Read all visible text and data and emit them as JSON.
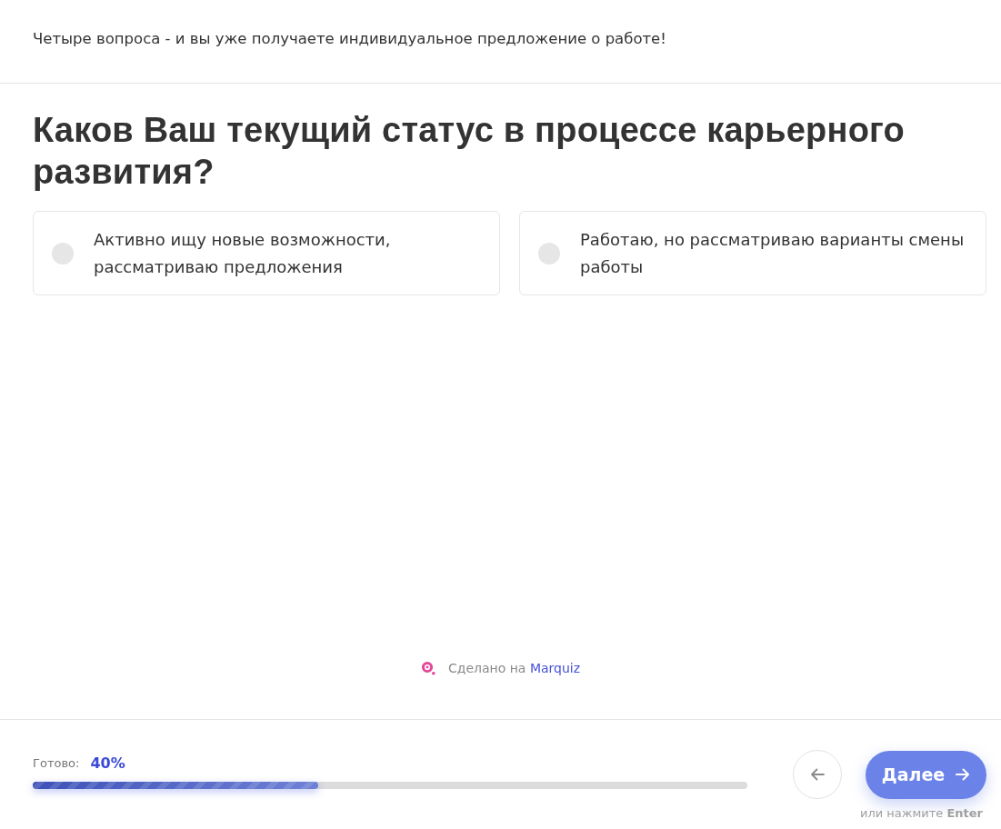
{
  "intro": "Четыре вопроса - и вы уже получаете индивидуальное предложение о работе!",
  "question": {
    "title": "Каков Ваш текущий статус в процессе карьерного развития?",
    "options": [
      {
        "label": "Активно ищу новые возможности, рассматриваю предложения",
        "selected": false
      },
      {
        "label": "Работаю, но рассматриваю варианты смены работы",
        "selected": false
      }
    ]
  },
  "branding": {
    "prefix": "Сделано на",
    "link": "Marquiz"
  },
  "footer": {
    "progress": {
      "label": "Готово:",
      "value": "40%",
      "level": 0.4
    },
    "next_button": {
      "label": "Далее"
    },
    "hint": "или нажмите **Enter**"
  }
}
